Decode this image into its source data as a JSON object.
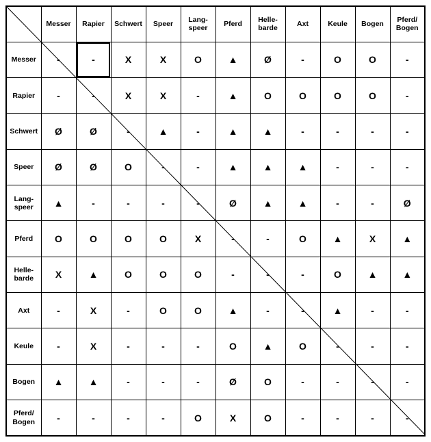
{
  "chart_data": {
    "type": "table",
    "title": "",
    "categories": [
      "Messer",
      "Rapier",
      "Schwert",
      "Speer",
      "Lang-\nspeer",
      "Pferd",
      "Helle-\nbarde",
      "Axt",
      "Keule",
      "Bogen",
      "Pferd/\nBogen"
    ],
    "symbols_legend": {
      "-": "dash",
      "X": "x",
      "O": "circle",
      "Ø": "slashed-o",
      "▲": "triangle"
    },
    "highlighted_cell": {
      "row": 0,
      "col": 1
    },
    "matrix": [
      [
        "-",
        "-",
        "X",
        "X",
        "O",
        "▲",
        "Ø",
        "-",
        "O",
        "O",
        "-"
      ],
      [
        "-",
        "-",
        "X",
        "X",
        "-",
        "▲",
        "O",
        "O",
        "O",
        "O",
        "-"
      ],
      [
        "Ø",
        "Ø",
        "-",
        "▲",
        "-",
        "▲",
        "▲",
        "-",
        "-",
        "-",
        "-"
      ],
      [
        "Ø",
        "Ø",
        "O",
        "-",
        "-",
        "▲",
        "▲",
        "▲",
        "-",
        "-",
        "-"
      ],
      [
        "▲",
        "-",
        "-",
        "-",
        "-",
        "Ø",
        "▲",
        "▲",
        "-",
        "-",
        "Ø"
      ],
      [
        "O",
        "O",
        "O",
        "O",
        "X",
        "-",
        "-",
        "O",
        "▲",
        "X",
        "▲"
      ],
      [
        "X",
        "▲",
        "O",
        "O",
        "O",
        "-",
        "-",
        "-",
        "O",
        "▲",
        "▲"
      ],
      [
        "-",
        "X",
        "-",
        "O",
        "O",
        "▲",
        "-",
        "-",
        "▲",
        "-",
        "-"
      ],
      [
        "-",
        "X",
        "-",
        "-",
        "-",
        "O",
        "▲",
        "O",
        "-",
        "-",
        "-"
      ],
      [
        "▲",
        "▲",
        "-",
        "-",
        "-",
        "Ø",
        "O",
        "-",
        "-",
        "-",
        "-"
      ],
      [
        "-",
        "-",
        "-",
        "-",
        "O",
        "X",
        "O",
        "-",
        "-",
        "-",
        "-"
      ]
    ]
  }
}
